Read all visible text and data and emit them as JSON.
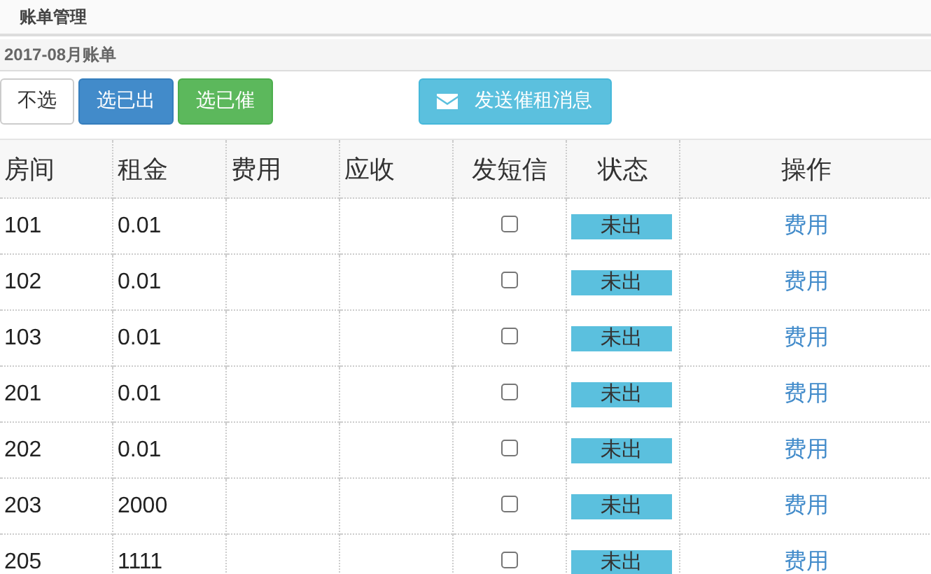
{
  "page_title": "账单管理",
  "panel": {
    "heading": "2017-08月账单"
  },
  "buttons": [
    {
      "label": "不选",
      "kind": "default"
    },
    {
      "label": "选已出",
      "kind": "primary"
    },
    {
      "label": "选已催",
      "kind": "success"
    }
  ],
  "send_button": {
    "label": "发送催租消息"
  },
  "table": {
    "columns": [
      "房间",
      "租金",
      "费用",
      "应收",
      "发短信",
      "状态",
      "操作"
    ],
    "rows": [
      {
        "room": "101",
        "rent": "0.01",
        "checked": false,
        "status": "未出",
        "action": "费用"
      },
      {
        "room": "102",
        "rent": "0.01",
        "checked": false,
        "status": "未出",
        "action": "费用"
      },
      {
        "room": "103",
        "rent": "0.01",
        "checked": false,
        "status": "未出",
        "action": "费用"
      },
      {
        "room": "201",
        "rent": "0.01",
        "checked": false,
        "status": "未出",
        "action": "费用"
      },
      {
        "room": "202",
        "rent": "0.01",
        "checked": false,
        "status": "未出",
        "action": "费用"
      },
      {
        "room": "203",
        "rent": "2000",
        "checked": false,
        "status": "未出",
        "action": "费用"
      },
      {
        "room": "205",
        "rent": "1111",
        "checked": false,
        "status": "未出",
        "action": "费用"
      }
    ]
  }
}
